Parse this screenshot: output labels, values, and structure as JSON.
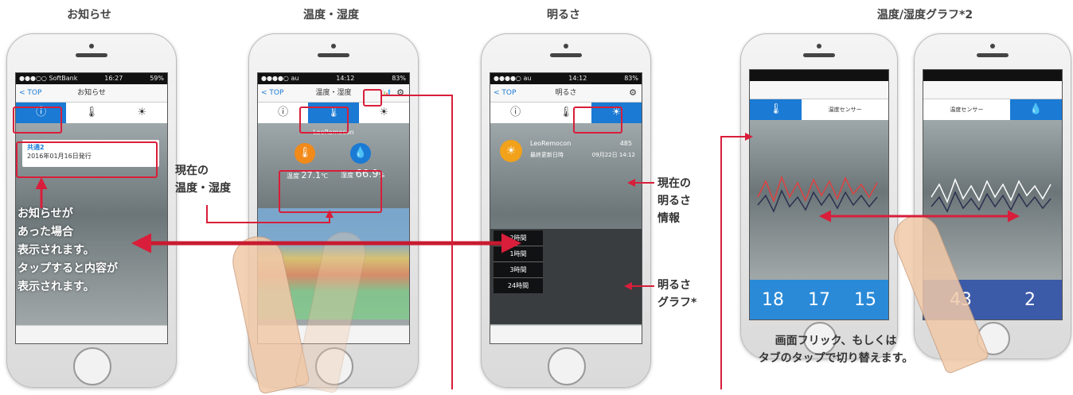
{
  "titles": [
    "お知らせ",
    "温度・湿度",
    "明るさ",
    "温度/湿度グラフ*2"
  ],
  "phone1": {
    "carrier": "●●●○○ SoftBank",
    "time": "16:27",
    "battery": "59%",
    "back": "< TOP",
    "nav_title": "お知らせ",
    "notice_title": "共通2",
    "notice_date": "2016年01月16日発行",
    "caption": [
      "お知らせが",
      "あった場合",
      "表示されます。",
      "タップすると内容が",
      "表示されます。"
    ]
  },
  "phone2": {
    "carrier": "●●●●○ au",
    "time": "14:12",
    "battery": "83%",
    "back": "< TOP",
    "nav_title": "温度・湿度",
    "device": "LeoRemocon",
    "temp_label": "温度",
    "temp_value": "27.1",
    "temp_unit": "℃",
    "hum_label": "湿度",
    "hum_value": "66.9",
    "hum_unit": "%"
  },
  "label_current_temp": [
    "現在の",
    "温度・湿度"
  ],
  "phone3": {
    "carrier": "●●●●○ au",
    "time": "14:12",
    "battery": "83%",
    "back": "< TOP",
    "nav_title": "明るさ",
    "device": "LeoRemocon",
    "lux": "485",
    "updated_label": "最終更新日時",
    "updated_value": "09月22日 14:12",
    "ranges": [
      "2時間",
      "1時間",
      "3時間",
      "24時間"
    ]
  },
  "label_light_info": [
    "現在の",
    "明るさ",
    "情報"
  ],
  "label_light_graph": [
    "明るさ",
    "グラフ*"
  ],
  "phone4": {
    "tab_sensor": "温度センサー",
    "temps": [
      "18",
      "17",
      "15"
    ]
  },
  "phone5": {
    "tab_sensor": "温度センサー",
    "hum": "43",
    "other": "2"
  },
  "flick_caption": [
    "画面フリック、もしくは",
    "タブのタップで切り替えます。"
  ],
  "colors": {
    "accent": "#1a7ad4",
    "annotation": "#d81e3a"
  },
  "icons": {
    "info": "ⓘ",
    "thermo": "🌡",
    "sun": "☀",
    "gear": "⚙",
    "graph": "📊"
  }
}
